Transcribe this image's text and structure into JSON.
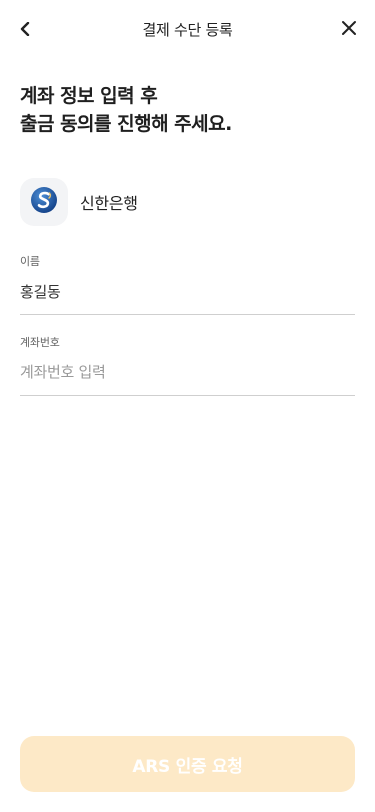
{
  "header": {
    "title": "결제 수단 등록",
    "back_icon": "chevron-left-icon",
    "close_icon": "close-icon"
  },
  "headline": {
    "line1": "계좌 정보 입력 후",
    "line2": "출금 동의를 진행해 주세요."
  },
  "bank": {
    "name": "신한은행",
    "logo_icon": "shinhan-bank-logo"
  },
  "fields": {
    "name": {
      "label": "이름",
      "value": "홍길동"
    },
    "account": {
      "label": "계좌번호",
      "value": "",
      "placeholder": "계좌번호 입력"
    }
  },
  "cta": {
    "label": "ARS 인증 요청",
    "enabled": false
  },
  "colors": {
    "cta_disabled_bg": "#fde9c7",
    "bank_logo_blue": "#1e5aa8"
  }
}
